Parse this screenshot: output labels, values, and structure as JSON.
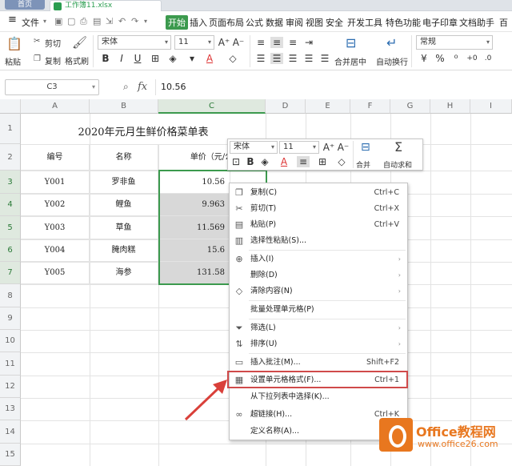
{
  "titlebar": {
    "home_tab": "首页",
    "doc_tab": "工作簿11.xlsx"
  },
  "menu": {
    "file": "文件",
    "items": [
      "开始",
      "插入",
      "页面布局",
      "公式",
      "数据",
      "审阅",
      "视图",
      "安全",
      "开发工具",
      "特色功能",
      "电子印章",
      "文档助手",
      "百"
    ]
  },
  "ribbon": {
    "cut": "剪切",
    "copy": "复制",
    "paste": "粘贴",
    "format_painter": "格式刷",
    "font_name": "宋体",
    "font_size": "11",
    "merge_center": "合并居中",
    "wrap_text": "自动换行",
    "number_format": "常规",
    "bold": "B",
    "italic": "I",
    "underline": "U",
    "increase_font": "A⁺",
    "decrease_font": "A⁻"
  },
  "formula_bar": {
    "cell_ref": "C3",
    "fx": "fx",
    "value": "10.56"
  },
  "grid": {
    "columns": [
      "A",
      "B",
      "C",
      "D",
      "E",
      "F",
      "G",
      "H",
      "I"
    ],
    "rows": [
      "1",
      "2",
      "3",
      "4",
      "5",
      "6",
      "7",
      "8",
      "9",
      "10",
      "11",
      "12",
      "13",
      "14",
      "15"
    ],
    "title": "2020年元月生鲜价格菜单表",
    "headers": [
      "编号",
      "名称",
      "单价（元/公"
    ],
    "data": [
      [
        "Y001",
        "罗非鱼",
        "10.56"
      ],
      [
        "Y002",
        "鲤鱼",
        "9.963"
      ],
      [
        "Y003",
        "草鱼",
        "11.569"
      ],
      [
        "Y004",
        "腌肉糕",
        "15.6"
      ],
      [
        "Y005",
        "海参",
        "131.58"
      ]
    ]
  },
  "mini_toolbar": {
    "font_name": "宋体",
    "font_size": "11",
    "merge": "合并",
    "autosum": "自动求和",
    "bold": "B",
    "sigma": "Σ"
  },
  "context_menu": {
    "items": [
      {
        "label": "复制(C)",
        "shortcut": "Ctrl+C",
        "icon": "copy-icon"
      },
      {
        "label": "剪切(T)",
        "shortcut": "Ctrl+X",
        "icon": "scissors-icon"
      },
      {
        "label": "粘贴(P)",
        "shortcut": "Ctrl+V",
        "icon": "paste-icon"
      },
      {
        "label": "选择性粘贴(S)...",
        "shortcut": "",
        "icon": "paste-special-icon"
      },
      {
        "label": "插入(I)",
        "shortcut": "",
        "icon": "insert-icon",
        "submenu": true
      },
      {
        "label": "删除(D)",
        "shortcut": "",
        "icon": "",
        "submenu": true
      },
      {
        "label": "清除内容(N)",
        "shortcut": "",
        "icon": "eraser-icon",
        "submenu": true
      },
      {
        "label": "批量处理单元格(P)",
        "shortcut": "",
        "icon": ""
      },
      {
        "label": "筛选(L)",
        "shortcut": "",
        "icon": "filter-icon",
        "submenu": true
      },
      {
        "label": "排序(U)",
        "shortcut": "",
        "icon": "sort-icon",
        "submenu": true
      },
      {
        "label": "插入批注(M)...",
        "shortcut": "Shift+F2",
        "icon": "comment-icon"
      },
      {
        "label": "设置单元格格式(F)...",
        "shortcut": "Ctrl+1",
        "icon": "format-cells-icon"
      },
      {
        "label": "从下拉列表中选择(K)...",
        "shortcut": "",
        "icon": ""
      },
      {
        "label": "超链接(H)...",
        "shortcut": "Ctrl+K",
        "icon": "link-icon"
      },
      {
        "label": "定义名称(A)...",
        "shortcut": "",
        "icon": ""
      }
    ]
  },
  "watermark": {
    "brand": "Office教程网",
    "url": "www.office26.com"
  },
  "colors": {
    "accent": "#3c9a4e",
    "highlight": "#d04a4a",
    "arrow": "#d9403a",
    "brand": "#e8771f"
  }
}
